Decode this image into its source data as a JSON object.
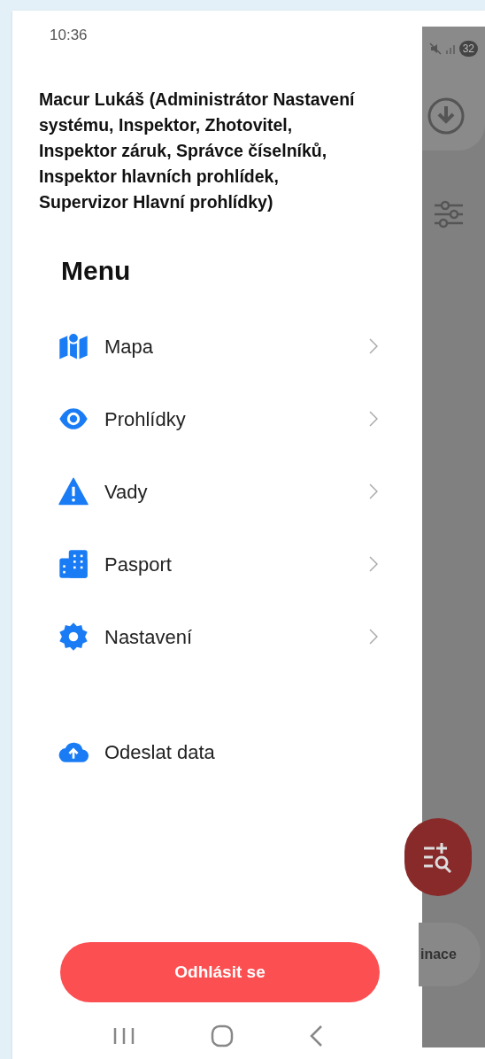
{
  "status_bar": {
    "time": "10:36",
    "battery": "32"
  },
  "user": {
    "text": "Macur Lukáš (Administrátor Nastavení systému, Inspektor, Zhotovitel, Inspektor záruk, Správce číselníků, Inspektor hlavních prohlídek, Supervizor Hlavní prohlídky)"
  },
  "menu": {
    "title": "Menu",
    "items": [
      {
        "label": "Mapa",
        "kind": "link"
      },
      {
        "label": "Prohlídky",
        "kind": "link"
      },
      {
        "label": "Vady",
        "kind": "link"
      },
      {
        "label": "Pasport",
        "kind": "link"
      },
      {
        "label": "Nastavení",
        "kind": "link"
      },
      {
        "label": "Odeslat data",
        "kind": "action"
      }
    ]
  },
  "logout_button": {
    "label": "Odhlásit se"
  },
  "background_app": {
    "chip_label": "inace"
  }
}
